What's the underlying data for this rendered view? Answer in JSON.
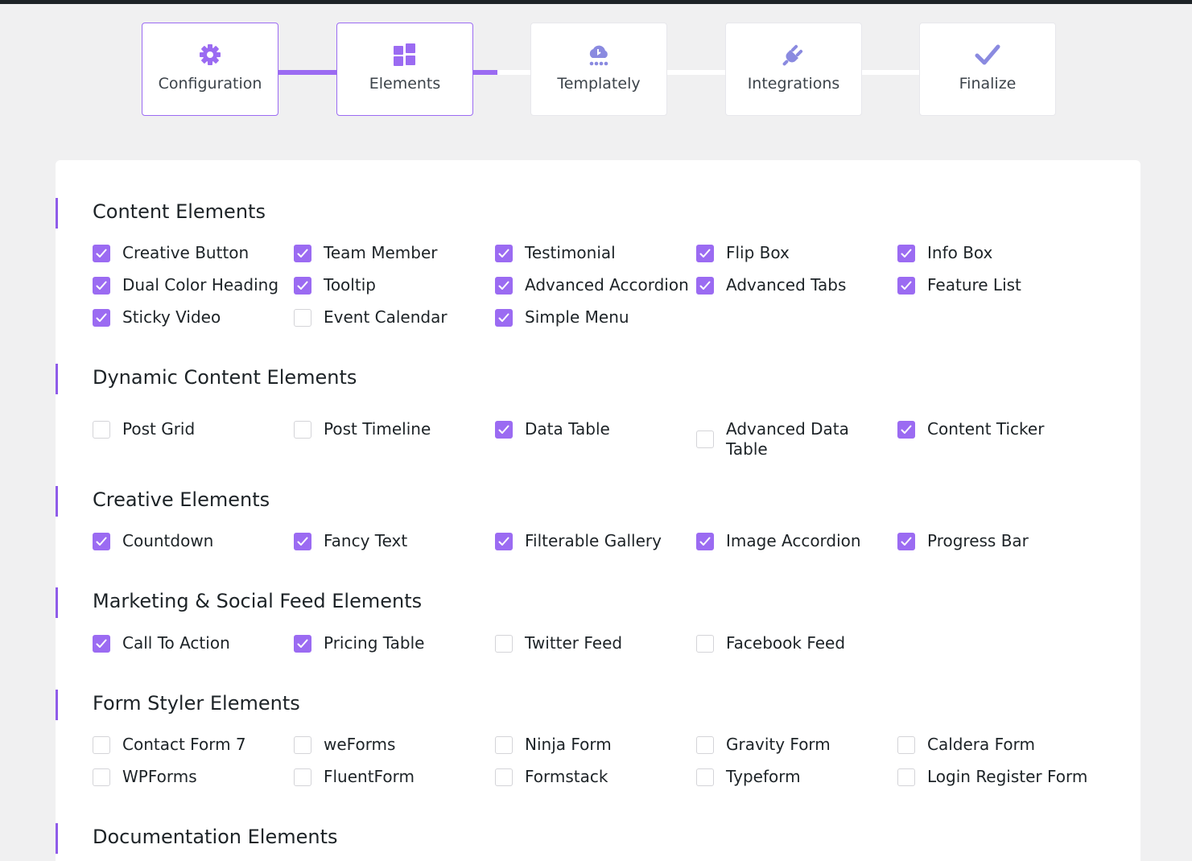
{
  "colors": {
    "accent": "#9b6bf2",
    "inactive_icon": "#8a8ae0"
  },
  "steps": [
    {
      "label": "Configuration",
      "icon": "gear-icon"
    },
    {
      "label": "Elements",
      "icon": "grid-icon"
    },
    {
      "label": "Templately",
      "icon": "cloud-icon"
    },
    {
      "label": "Integrations",
      "icon": "plug-icon"
    },
    {
      "label": "Finalize",
      "icon": "check-icon"
    }
  ],
  "sections": [
    {
      "title": "Content Elements",
      "items": [
        {
          "label": "Creative Button",
          "checked": true
        },
        {
          "label": "Team Member",
          "checked": true
        },
        {
          "label": "Testimonial",
          "checked": true
        },
        {
          "label": "Flip Box",
          "checked": true
        },
        {
          "label": "Info Box",
          "checked": true
        },
        {
          "label": "Dual Color Heading",
          "checked": true
        },
        {
          "label": "Tooltip",
          "checked": true
        },
        {
          "label": "Advanced Accordion",
          "checked": true
        },
        {
          "label": "Advanced Tabs",
          "checked": true
        },
        {
          "label": "Feature List",
          "checked": true
        },
        {
          "label": "Sticky Video",
          "checked": true
        },
        {
          "label": "Event Calendar",
          "checked": false
        },
        {
          "label": "Simple Menu",
          "checked": true
        }
      ]
    },
    {
      "title": "Dynamic Content Elements",
      "items": [
        {
          "label": "Post Grid",
          "checked": false
        },
        {
          "label": "Post Timeline",
          "checked": false
        },
        {
          "label": "Data Table",
          "checked": true
        },
        {
          "label": "Advanced Data Table",
          "checked": false
        },
        {
          "label": "Content Ticker",
          "checked": true
        }
      ]
    },
    {
      "title": "Creative Elements",
      "items": [
        {
          "label": "Countdown",
          "checked": true
        },
        {
          "label": "Fancy Text",
          "checked": true
        },
        {
          "label": "Filterable Gallery",
          "checked": true
        },
        {
          "label": "Image Accordion",
          "checked": true
        },
        {
          "label": "Progress Bar",
          "checked": true
        }
      ]
    },
    {
      "title": "Marketing & Social Feed Elements",
      "items": [
        {
          "label": "Call To Action",
          "checked": true
        },
        {
          "label": "Pricing Table",
          "checked": true
        },
        {
          "label": "Twitter Feed",
          "checked": false
        },
        {
          "label": "Facebook Feed",
          "checked": false
        }
      ]
    },
    {
      "title": "Form Styler Elements",
      "items": [
        {
          "label": "Contact Form 7",
          "checked": false
        },
        {
          "label": "weForms",
          "checked": false
        },
        {
          "label": "Ninja Form",
          "checked": false
        },
        {
          "label": "Gravity Form",
          "checked": false
        },
        {
          "label": "Caldera Form",
          "checked": false
        },
        {
          "label": "WPForms",
          "checked": false
        },
        {
          "label": "FluentForm",
          "checked": false
        },
        {
          "label": "Formstack",
          "checked": false
        },
        {
          "label": "Typeform",
          "checked": false
        },
        {
          "label": "Login Register Form",
          "checked": false
        }
      ]
    },
    {
      "title": "Documentation Elements",
      "items": []
    }
  ]
}
